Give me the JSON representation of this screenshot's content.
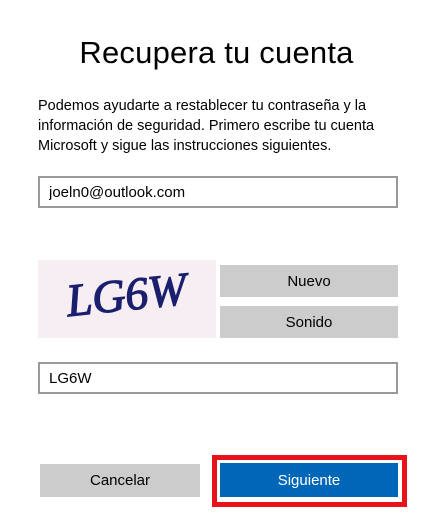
{
  "page": {
    "title": "Recupera tu cuenta",
    "description": "Podemos ayudarte a restablecer tu contraseña y la información de seguridad. Primero escribe tu cuenta Microsoft y sigue las instrucciones siguientes."
  },
  "account": {
    "email_value": "joeln0@outlook.com"
  },
  "captcha": {
    "image_text": "LG6W",
    "new_label": "Nuevo",
    "audio_label": "Sonido",
    "input_value": "LG6W"
  },
  "actions": {
    "cancel_label": "Cancelar",
    "next_label": "Siguiente"
  },
  "colors": {
    "primary_button": "#0067b8",
    "secondary_button": "#cccccc",
    "highlight_border": "#e8121a",
    "input_border": "#9a9a9a",
    "captcha_background": "#f7eef3",
    "captcha_ink": "#1a1f6e"
  }
}
